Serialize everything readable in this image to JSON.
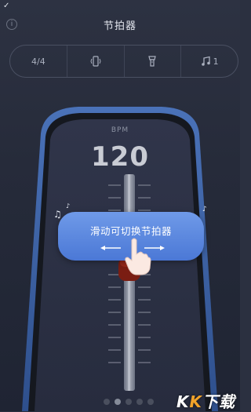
{
  "status": {
    "check": "✓"
  },
  "header": {
    "title": "节拍器",
    "info_icon": "info-icon"
  },
  "toolbar": {
    "time_signature": "4/4",
    "vibrate_icon": "phone-vibrate-icon",
    "flashlight_icon": "flashlight-icon",
    "sound_icon": "music-note-icon",
    "sound_value": "1"
  },
  "metronome": {
    "bpm_label": "BPM",
    "bpm_value": "120",
    "hint_text": "滑动可切换节拍器",
    "pointer_icon": "hand-pointer-icon"
  },
  "pager": {
    "count": 5,
    "active_index": 1
  },
  "watermark": {
    "text_a": "K",
    "text_b": "K",
    "text_c": "下载"
  },
  "colors": {
    "background": "#262b3a",
    "hint_bubble": "#5b86dc",
    "pendulum_weight": "#7a1d12",
    "frame": "#3e64a8"
  }
}
